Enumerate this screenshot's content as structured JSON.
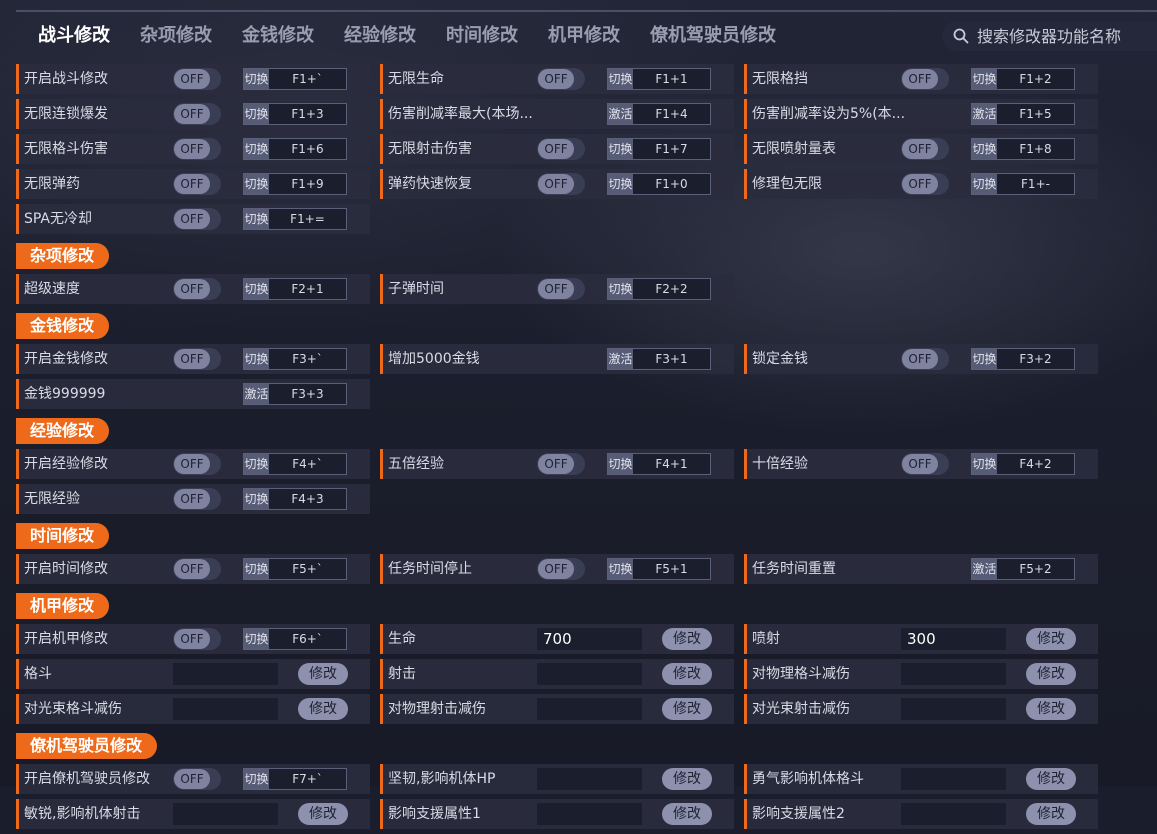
{
  "tabs": [
    "战斗修改",
    "杂项修改",
    "金钱修改",
    "经验修改",
    "时间修改",
    "机甲修改",
    "僚机驾驶员修改"
  ],
  "search": {
    "placeholder": "搜索修改器功能名称"
  },
  "sections": [
    {
      "title": null,
      "rows": [
        [
          {
            "type": "toggle",
            "label": "开启战斗修改",
            "state": "OFF",
            "mode": "切换",
            "key": "F1+`"
          },
          {
            "type": "toggle",
            "label": "无限生命",
            "state": "OFF",
            "mode": "切换",
            "key": "F1+1"
          },
          {
            "type": "toggle",
            "label": "无限格挡",
            "state": "OFF",
            "mode": "切换",
            "key": "F1+2"
          }
        ],
        [
          {
            "type": "toggle",
            "label": "无限连锁爆发",
            "state": "OFF",
            "mode": "切换",
            "key": "F1+3"
          },
          {
            "type": "action",
            "label": "伤害削减率最大(本场...",
            "mode": "激活",
            "key": "F1+4"
          },
          {
            "type": "action",
            "label": "伤害削减率设为5%(本...",
            "mode": "激活",
            "key": "F1+5"
          }
        ],
        [
          {
            "type": "toggle",
            "label": "无限格斗伤害",
            "state": "OFF",
            "mode": "切换",
            "key": "F1+6"
          },
          {
            "type": "toggle",
            "label": "无限射击伤害",
            "state": "OFF",
            "mode": "切换",
            "key": "F1+7"
          },
          {
            "type": "toggle",
            "label": "无限喷射量表",
            "state": "OFF",
            "mode": "切换",
            "key": "F1+8"
          }
        ],
        [
          {
            "type": "toggle",
            "label": "无限弹药",
            "state": "OFF",
            "mode": "切换",
            "key": "F1+9"
          },
          {
            "type": "toggle",
            "label": "弹药快速恢复",
            "state": "OFF",
            "mode": "切换",
            "key": "F1+0"
          },
          {
            "type": "toggle",
            "label": "修理包无限",
            "state": "OFF",
            "mode": "切换",
            "key": "F1+-"
          }
        ],
        [
          {
            "type": "toggle",
            "label": "SPA无冷却",
            "state": "OFF",
            "mode": "切换",
            "key": "F1+="
          }
        ]
      ]
    },
    {
      "title": "杂项修改",
      "rows": [
        [
          {
            "type": "toggle",
            "label": "超级速度",
            "state": "OFF",
            "mode": "切换",
            "key": "F2+1"
          },
          {
            "type": "toggle",
            "label": "子弹时间",
            "state": "OFF",
            "mode": "切换",
            "key": "F2+2"
          }
        ]
      ]
    },
    {
      "title": "金钱修改",
      "rows": [
        [
          {
            "type": "toggle",
            "label": "开启金钱修改",
            "state": "OFF",
            "mode": "切换",
            "key": "F3+`"
          },
          {
            "type": "action",
            "label": "增加5000金钱",
            "mode": "激活",
            "key": "F3+1"
          },
          {
            "type": "toggle",
            "label": "锁定金钱",
            "state": "OFF",
            "mode": "切换",
            "key": "F3+2"
          }
        ],
        [
          {
            "type": "action",
            "label": "金钱999999",
            "mode": "激活",
            "key": "F3+3"
          }
        ]
      ]
    },
    {
      "title": "经验修改",
      "rows": [
        [
          {
            "type": "toggle",
            "label": "开启经验修改",
            "state": "OFF",
            "mode": "切换",
            "key": "F4+`"
          },
          {
            "type": "toggle",
            "label": "五倍经验",
            "state": "OFF",
            "mode": "切换",
            "key": "F4+1"
          },
          {
            "type": "toggle",
            "label": "十倍经验",
            "state": "OFF",
            "mode": "切换",
            "key": "F4+2"
          }
        ],
        [
          {
            "type": "toggle",
            "label": "无限经验",
            "state": "OFF",
            "mode": "切换",
            "key": "F4+3"
          }
        ]
      ]
    },
    {
      "title": "时间修改",
      "rows": [
        [
          {
            "type": "toggle",
            "label": "开启时间修改",
            "state": "OFF",
            "mode": "切换",
            "key": "F5+`"
          },
          {
            "type": "toggle",
            "label": "任务时间停止",
            "state": "OFF",
            "mode": "切换",
            "key": "F5+1"
          },
          {
            "type": "action",
            "label": "任务时间重置",
            "mode": "激活",
            "key": "F5+2"
          }
        ]
      ]
    },
    {
      "title": "机甲修改",
      "rows": [
        [
          {
            "type": "toggle",
            "label": "开启机甲修改",
            "state": "OFF",
            "mode": "切换",
            "key": "F6+`"
          },
          {
            "type": "value",
            "label": "生命",
            "value": "700",
            "button": "修改"
          },
          {
            "type": "value",
            "label": "喷射",
            "value": "300",
            "button": "修改"
          }
        ],
        [
          {
            "type": "value",
            "label": "格斗",
            "value": "",
            "button": "修改"
          },
          {
            "type": "value",
            "label": "射击",
            "value": "",
            "button": "修改"
          },
          {
            "type": "value",
            "label": "对物理格斗减伤",
            "value": "",
            "button": "修改"
          }
        ],
        [
          {
            "type": "value",
            "label": "对光束格斗减伤",
            "value": "",
            "button": "修改"
          },
          {
            "type": "value",
            "label": "对物理射击减伤",
            "value": "",
            "button": "修改"
          },
          {
            "type": "value",
            "label": "对光束射击减伤",
            "value": "",
            "button": "修改"
          }
        ]
      ]
    },
    {
      "title": "僚机驾驶员修改",
      "rows": [
        [
          {
            "type": "toggle",
            "label": "开启僚机驾驶员修改",
            "state": "OFF",
            "mode": "切换",
            "key": "F7+`"
          },
          {
            "type": "value",
            "label": "坚韧,影响机体HP",
            "value": "",
            "button": "修改"
          },
          {
            "type": "value",
            "label": "勇气影响机体格斗",
            "value": "",
            "button": "修改"
          }
        ],
        [
          {
            "type": "value",
            "label": "敏锐,影响机体射击",
            "value": "",
            "button": "修改"
          },
          {
            "type": "value",
            "label": "影响支援属性1",
            "value": "",
            "button": "修改"
          },
          {
            "type": "value",
            "label": "影响支援属性2",
            "value": "",
            "button": "修改"
          }
        ]
      ]
    }
  ]
}
